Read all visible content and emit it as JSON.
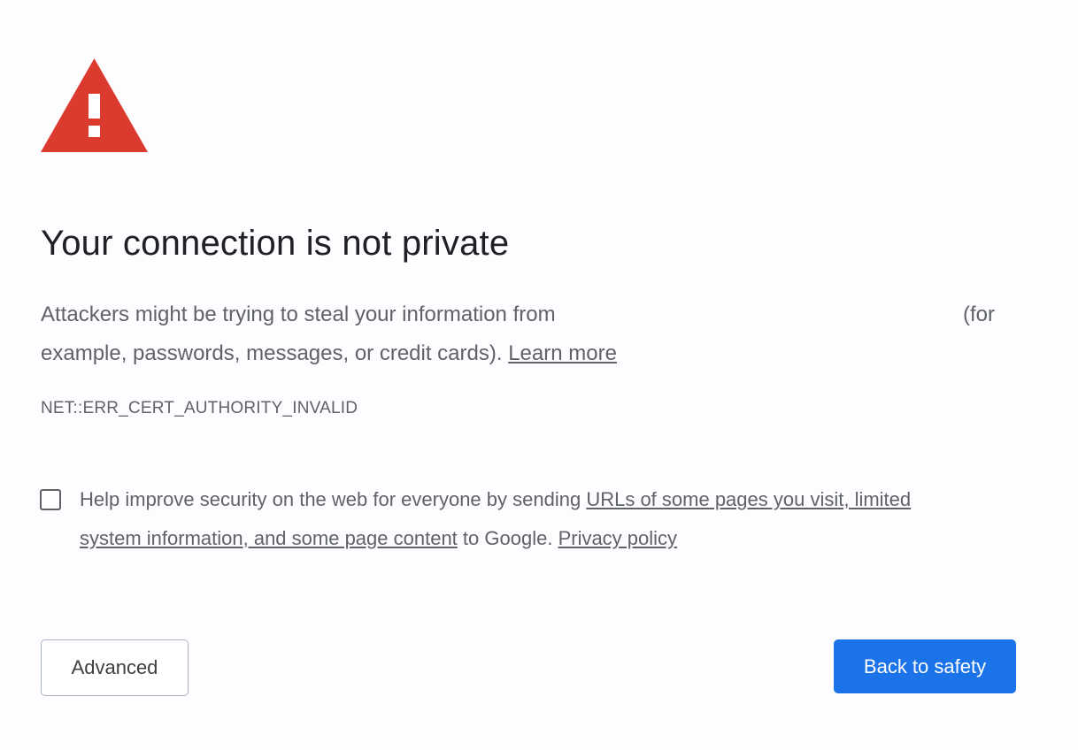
{
  "warning_icon": {
    "name": "warning-triangle-icon",
    "color": "#db3a2f",
    "glyph": "!"
  },
  "title": "Your connection is not private",
  "description": {
    "line1": "Attackers might be trying to steal your information from",
    "line1_end": "(for",
    "line2": "example, passwords, messages, or credit cards).",
    "learn_more": "Learn more"
  },
  "error_code": "NET::ERR_CERT_AUTHORITY_INVALID",
  "opt_in": {
    "checked": false,
    "text_before": "Help improve security on the web for everyone by sending",
    "link_part1": "URLs of some pages you visit, limited",
    "link_part2": "system information, and some page content",
    "text_after": "to Google.",
    "privacy_link": "Privacy policy"
  },
  "buttons": {
    "advanced": "Advanced",
    "back_to_safety": "Back to safety"
  },
  "colors": {
    "primary_button": "#1a73e8",
    "warning_red": "#db3a2f",
    "text_secondary": "#5f6368"
  }
}
